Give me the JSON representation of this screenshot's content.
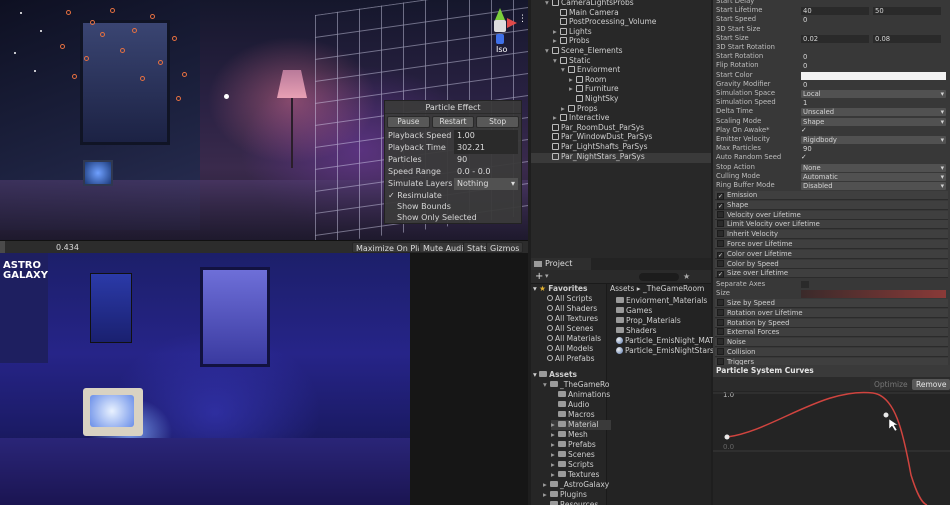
{
  "scene_view": {
    "gizmo_label": "Iso",
    "particle_effect": {
      "title": "Particle Effect",
      "buttons": [
        "Pause",
        "Restart",
        "Stop"
      ],
      "rows": [
        {
          "label": "Playback Speed",
          "value": "1.00"
        },
        {
          "label": "Playback Time",
          "value": "302.21"
        },
        {
          "label": "Particles",
          "value": "90"
        },
        {
          "label": "Speed Range",
          "value": "0.0 - 0.0"
        },
        {
          "label": "Simulate Layers",
          "value": "Nothing"
        }
      ],
      "checks": [
        {
          "label": "Resimulate",
          "checked": true
        },
        {
          "label": "Show Bounds",
          "checked": false
        },
        {
          "label": "Show Only Selected",
          "checked": false
        }
      ]
    },
    "bar": {
      "frame": "0.434",
      "progress": 0.1,
      "maximize": "Maximize On Play",
      "mute": "Mute Audio",
      "stats": "Stats",
      "gizmos": "Gizmos"
    }
  },
  "game_view": {
    "banner_text": "ASTRO GALAXY"
  },
  "hierarchy": {
    "items": [
      {
        "label": "CameraLightsProbs",
        "depth": 1,
        "arrow": "▾"
      },
      {
        "label": "Main Camera",
        "depth": 2,
        "arrow": ""
      },
      {
        "label": "PostProcessing_Volume",
        "depth": 2,
        "arrow": ""
      },
      {
        "label": "Lights",
        "depth": 2,
        "arrow": "▸"
      },
      {
        "label": "Probs",
        "depth": 2,
        "arrow": "▸"
      },
      {
        "label": "Scene_Elements",
        "depth": 1,
        "arrow": "▾"
      },
      {
        "label": "Static",
        "depth": 2,
        "arrow": "▾"
      },
      {
        "label": "Enviorment",
        "depth": 3,
        "arrow": "▾"
      },
      {
        "label": "Room",
        "depth": 4,
        "arrow": "▸"
      },
      {
        "label": "Furniture",
        "depth": 4,
        "arrow": "▸"
      },
      {
        "label": "NightSky",
        "depth": 4,
        "arrow": ""
      },
      {
        "label": "Props",
        "depth": 3,
        "arrow": "▸"
      },
      {
        "label": "Interactive",
        "depth": 2,
        "arrow": "▸"
      },
      {
        "label": "Par_RoomDust_ParSys",
        "depth": 1,
        "arrow": ""
      },
      {
        "label": "Par_WindowDust_ParSys",
        "depth": 1,
        "arrow": ""
      },
      {
        "label": "Par_LightShafts_ParSys",
        "depth": 1,
        "arrow": ""
      },
      {
        "label": "Par_NightStars_ParSys",
        "depth": 1,
        "arrow": ""
      }
    ]
  },
  "project": {
    "tab": "Project",
    "breadcrumb": [
      "Assets",
      "_TheGameRoom"
    ],
    "favorites_label": "Favorites",
    "favorites": [
      "All Scripts",
      "All Shaders",
      "All Textures",
      "All Scenes",
      "All Materials",
      "All Models",
      "All Prefabs"
    ],
    "assets_label": "Assets",
    "assets_tree": [
      {
        "label": "_TheGameRo",
        "depth": 1,
        "arrow": "▾"
      },
      {
        "label": "Animations",
        "depth": 2,
        "arrow": ""
      },
      {
        "label": "Audio",
        "depth": 2,
        "arrow": ""
      },
      {
        "label": "Macros",
        "depth": 2,
        "arrow": ""
      },
      {
        "label": "Material",
        "depth": 2,
        "arrow": "▸"
      },
      {
        "label": "Mesh",
        "depth": 2,
        "arrow": "▸"
      },
      {
        "label": "Prefabs",
        "depth": 2,
        "arrow": "▸"
      },
      {
        "label": "Scenes",
        "depth": 2,
        "arrow": "▸"
      },
      {
        "label": "Scripts",
        "depth": 2,
        "arrow": "▸"
      },
      {
        "label": "Textures",
        "depth": 2,
        "arrow": "▸"
      },
      {
        "label": "_AstroGalaxy",
        "depth": 1,
        "arrow": "▸"
      },
      {
        "label": "Plugins",
        "depth": 1,
        "arrow": "▸"
      },
      {
        "label": "Resources",
        "depth": 1,
        "arrow": ""
      }
    ],
    "files": [
      {
        "label": "Enviorment_Materials",
        "kind": "folder"
      },
      {
        "label": "Games",
        "kind": "folder"
      },
      {
        "label": "Prop_Materials",
        "kind": "folder"
      },
      {
        "label": "Shaders",
        "kind": "folder"
      },
      {
        "label": "Particle_EmisNight_MAT",
        "kind": "material"
      },
      {
        "label": "Particle_EmisNightStars_",
        "kind": "material"
      }
    ]
  },
  "inspector": {
    "rows": [
      {
        "label": "Start Delay",
        "value": ""
      },
      {
        "label": "Start Lifetime",
        "value": "40",
        "value2": "50"
      },
      {
        "label": "Start Speed",
        "value": "0"
      },
      {
        "label": "3D Start Size",
        "value": ""
      },
      {
        "label": "Start Size",
        "value": "0.02",
        "value2": "0.08"
      },
      {
        "label": "3D Start Rotation",
        "value": ""
      },
      {
        "label": "Start Rotation",
        "value": "0"
      },
      {
        "label": "Flip Rotation",
        "value": "0"
      },
      {
        "label": "Start Color",
        "value": ""
      },
      {
        "label": "Gravity Modifier",
        "value": "0"
      },
      {
        "label": "Simulation Space",
        "value": "Local",
        "dropdown": true
      },
      {
        "label": "Simulation Speed",
        "value": "1"
      },
      {
        "label": "Delta Time",
        "value": "Unscaled",
        "dropdown": true
      },
      {
        "label": "Scaling Mode",
        "value": "Shape",
        "dropdown": true
      },
      {
        "label": "Play On Awake*",
        "value": "✓",
        "check": true
      },
      {
        "label": "Emitter Velocity",
        "value": "Rigidbody",
        "dropdown": true
      },
      {
        "label": "Max Particles",
        "value": "90"
      },
      {
        "label": "Auto Random Seed",
        "value": "✓",
        "check": true
      },
      {
        "label": "Stop Action",
        "value": "None",
        "dropdown": true
      },
      {
        "label": "Culling Mode",
        "value": "Automatic",
        "dropdown": true
      },
      {
        "label": "Ring Buffer Mode",
        "value": "Disabled",
        "dropdown": true
      }
    ],
    "modules": [
      {
        "label": "Emission",
        "checked": true
      },
      {
        "label": "Shape",
        "checked": true
      },
      {
        "label": "Velocity over Lifetime",
        "checked": false
      },
      {
        "label": "Limit Velocity over Lifetime",
        "checked": false
      },
      {
        "label": "Inherit Velocity",
        "checked": false
      },
      {
        "label": "Force over Lifetime",
        "checked": false
      },
      {
        "label": "Color over Lifetime",
        "checked": true
      },
      {
        "label": "Color by Speed",
        "checked": false
      },
      {
        "label": "Size over Lifetime",
        "checked": true
      }
    ],
    "separate_axes": "Separate Axes",
    "size_label": "Size",
    "modules2": [
      {
        "label": "Size by Speed",
        "checked": false
      },
      {
        "label": "Rotation over Lifetime",
        "checked": false
      },
      {
        "label": "Rotation by Speed",
        "checked": false
      },
      {
        "label": "External Forces",
        "checked": false
      },
      {
        "label": "Noise",
        "checked": false
      },
      {
        "label": "Collision",
        "checked": false
      },
      {
        "label": "Triggers",
        "checked": false
      }
    ]
  },
  "curves": {
    "title": "Particle System Curves",
    "optimize": "Optimize",
    "remove": "Remove",
    "y_top": "1.0",
    "y_bottom": "0.0",
    "curve_color": "#d0443f"
  },
  "colors": {
    "accent": "#d0443f",
    "selection": "#3a3a3a",
    "panel": "#383838"
  }
}
